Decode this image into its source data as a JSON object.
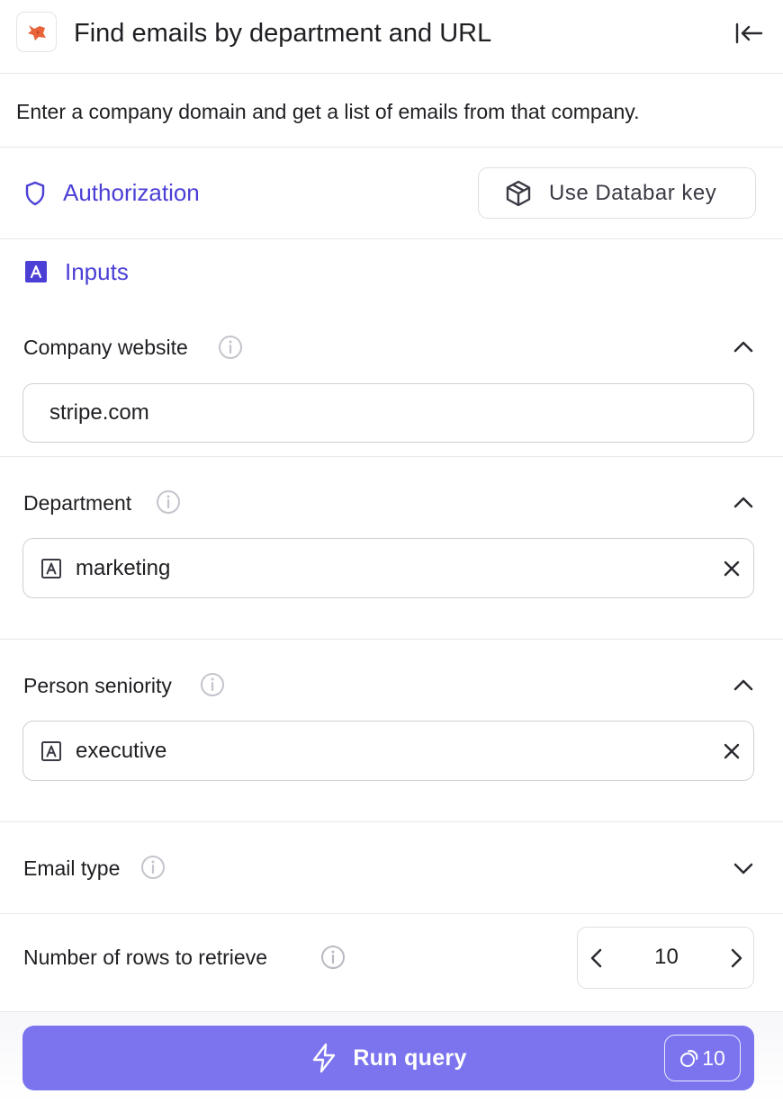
{
  "header": {
    "title": "Find emails by department and URL",
    "logo_icon": "fox-logo-icon",
    "collapse_icon": "collapse-left-icon"
  },
  "description": "Enter a company domain and get a list of emails from that company.",
  "authorization": {
    "title": "Authorization",
    "icon": "shield-icon",
    "key_button_label": "Use Databar key",
    "key_button_icon": "cube-icon"
  },
  "inputs": {
    "title": "Inputs",
    "icon": "text-a-icon",
    "fields": [
      {
        "label": "Company website",
        "value": "stripe.com",
        "expanded": true
      },
      {
        "label": "Department",
        "value": "marketing",
        "expanded": true
      },
      {
        "label": "Person seniority",
        "value": "executive",
        "expanded": true
      },
      {
        "label": "Email type",
        "expanded": false
      },
      {
        "label": "Number of rows to retrieve",
        "value": "10"
      }
    ]
  },
  "footer": {
    "run_label": "Run query",
    "credits": "10"
  },
  "colors": {
    "accent": "#4b3fd6",
    "run_button": "#7b74ee",
    "logo": "#e8633a"
  }
}
